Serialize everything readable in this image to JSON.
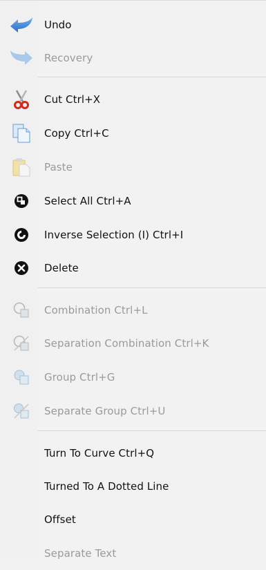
{
  "menu": {
    "items": [
      {
        "label": "Undo",
        "enabled": true,
        "icon": "undo-arrow-icon"
      },
      {
        "label": "Recovery",
        "enabled": false,
        "icon": "redo-arrow-icon"
      },
      {
        "label": "Cut Ctrl+X",
        "enabled": true,
        "icon": "scissors-icon"
      },
      {
        "label": "Copy Ctrl+C",
        "enabled": true,
        "icon": "copy-icon"
      },
      {
        "label": "Paste",
        "enabled": false,
        "icon": "paste-icon"
      },
      {
        "label": "Select All Ctrl+A",
        "enabled": true,
        "icon": "select-all-icon"
      },
      {
        "label": "Inverse Selection (I) Ctrl+I",
        "enabled": true,
        "icon": "inverse-selection-icon"
      },
      {
        "label": "Delete",
        "enabled": true,
        "icon": "delete-x-icon"
      },
      {
        "label": "Combination Ctrl+L",
        "enabled": false,
        "icon": "combination-icon"
      },
      {
        "label": "Separation Combination Ctrl+K",
        "enabled": false,
        "icon": "separation-combination-icon"
      },
      {
        "label": "Group Ctrl+G",
        "enabled": false,
        "icon": "group-icon"
      },
      {
        "label": "Separate Group Ctrl+U",
        "enabled": false,
        "icon": "separate-group-icon"
      },
      {
        "label": "Turn To Curve Ctrl+Q",
        "enabled": true,
        "icon": ""
      },
      {
        "label": "Turned To A Dotted Line",
        "enabled": true,
        "icon": ""
      },
      {
        "label": "Offset",
        "enabled": true,
        "icon": ""
      },
      {
        "label": "Separate Text",
        "enabled": false,
        "icon": ""
      }
    ]
  },
  "colors": {
    "background": "#f2f2f2",
    "text": "#111111",
    "disabled_text": "#9a9a9a",
    "separator": "#d6d6d6",
    "undo_blue": "#3a7fd5",
    "scissors_red": "#d42a1e"
  }
}
